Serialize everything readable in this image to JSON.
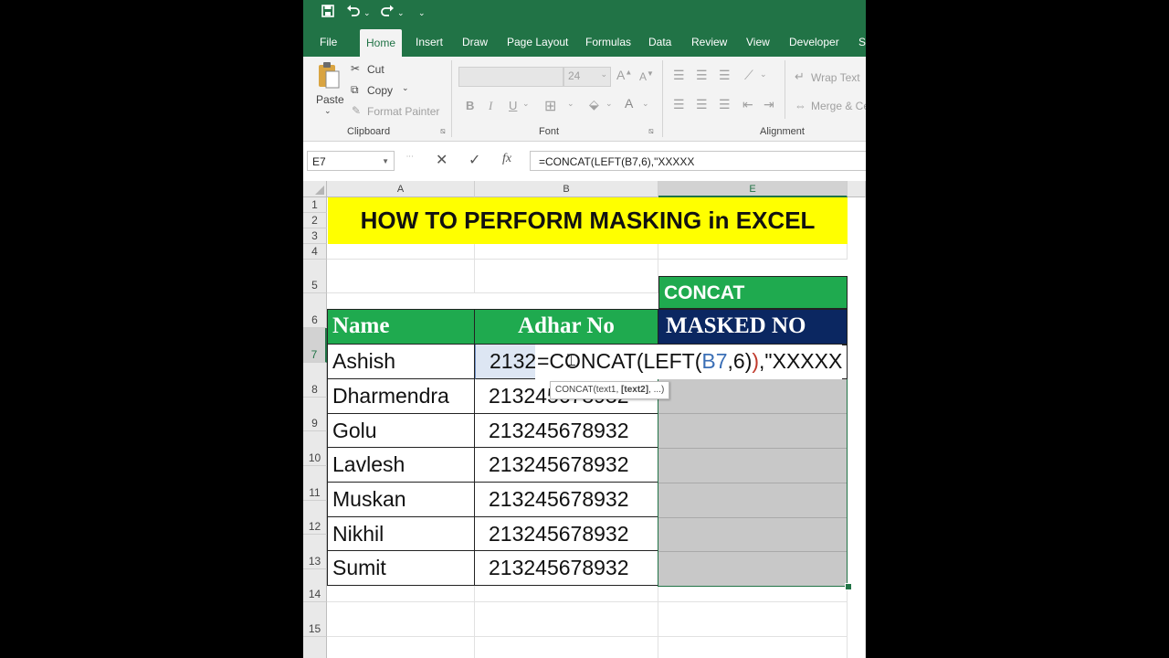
{
  "qat": {
    "save_icon": "save-icon",
    "undo_icon": "undo-icon",
    "redo_icon": "redo-icon",
    "customize_icon": "customize-icon"
  },
  "tabs": [
    "File",
    "Home",
    "Insert",
    "Draw",
    "Page Layout",
    "Formulas",
    "Data",
    "Review",
    "View",
    "Developer",
    "S"
  ],
  "active_tab": "Home",
  "ribbon": {
    "clipboard": {
      "paste": "Paste",
      "cut": "Cut",
      "copy": "Copy",
      "format_painter": "Format Painter",
      "group": "Clipboard"
    },
    "font": {
      "size": "24",
      "bold": "B",
      "italic": "I",
      "underline": "U",
      "font_color": "A",
      "group": "Font"
    },
    "alignment": {
      "wrap_text": "Wrap Text",
      "merge": "Merge & Ce",
      "group": "Alignment"
    }
  },
  "formula_bar": {
    "name_box": "E7",
    "cancel": "✕",
    "enter": "✓",
    "fx": "fx",
    "formula": "=CONCAT(LEFT(B7,6),\"XXXXX"
  },
  "columns": [
    "A",
    "B",
    "E"
  ],
  "rows": [
    "1",
    "2",
    "3",
    "4",
    "5",
    "6",
    "7",
    "8",
    "9",
    "10",
    "11",
    "12",
    "13",
    "14",
    "15"
  ],
  "sheet": {
    "title": "HOW TO PERFORM MASKING in EXCEL",
    "concat_label": "CONCAT",
    "headers": {
      "name": "Name",
      "adhar": "Adhar No",
      "masked": "MASKED NO"
    },
    "records": [
      {
        "name": "Ashish",
        "adhar": "2132"
      },
      {
        "name": "Dharmendra",
        "adhar": "213245678932"
      },
      {
        "name": "Golu",
        "adhar": "213245678932"
      },
      {
        "name": "Lavlesh",
        "adhar": "213245678932"
      },
      {
        "name": "Muskan",
        "adhar": "213245678932"
      },
      {
        "name": "Nikhil",
        "adhar": "213245678932"
      },
      {
        "name": "Sumit",
        "adhar": "213245678932"
      }
    ],
    "edit_formula": {
      "prefix": "=CONCAT(LEFT(",
      "ref": "B7",
      "suffix": ",6)",
      "paren": ")",
      "rest": ",\"XXXXX"
    },
    "tooltip": {
      "func": "CONCAT(text1, ",
      "bold_arg": "[text2]",
      "tail": ", ...)"
    }
  },
  "colors": {
    "excel_green": "#217346",
    "header_green": "#1faa4f",
    "masked_navy": "#0b2761",
    "title_yellow": "#ffff00",
    "fill_gray": "#c8c8c8"
  }
}
